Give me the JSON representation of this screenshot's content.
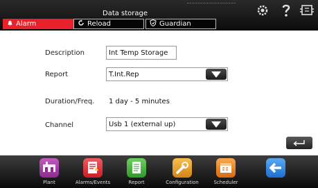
{
  "header": {
    "title": "Data storage",
    "tabs": [
      {
        "label": "Alarm",
        "icon": "bell-icon",
        "active": true,
        "color": "#e8212a"
      },
      {
        "label": "Reload",
        "icon": "reload-icon"
      },
      {
        "label": "Guardian",
        "icon": "shield-icon"
      }
    ],
    "right_icons": [
      "gear-icon",
      "help-icon",
      "pin-icon"
    ]
  },
  "form": {
    "description_label": "Description",
    "description_value": "Int Temp Storage",
    "report_label": "Report",
    "report_value": "T.Int.Rep",
    "duration_label": "Duration/Freq.",
    "duration_value": "1 day - 5 minutes",
    "channel_label": "Channel",
    "channel_value": "Usb 1 (external up)"
  },
  "enter_icon": "enter-icon",
  "bottom_nav": [
    {
      "label": "Plant",
      "icon": "plant-icon",
      "color": "#a23aa0"
    },
    {
      "label": "Alarms/Events",
      "icon": "alarm-events-icon",
      "color": "#e6303a"
    },
    {
      "label": "Report",
      "icon": "report-icon",
      "color": "#46b83e"
    },
    {
      "label": "Configuration",
      "icon": "configuration-icon",
      "color": "#f0a322"
    },
    {
      "label": "Scheduler",
      "icon": "scheduler-icon",
      "color": "#f08a22"
    },
    {
      "label": "",
      "icon": "back-arrow-icon",
      "color": "#2d86e0"
    }
  ]
}
